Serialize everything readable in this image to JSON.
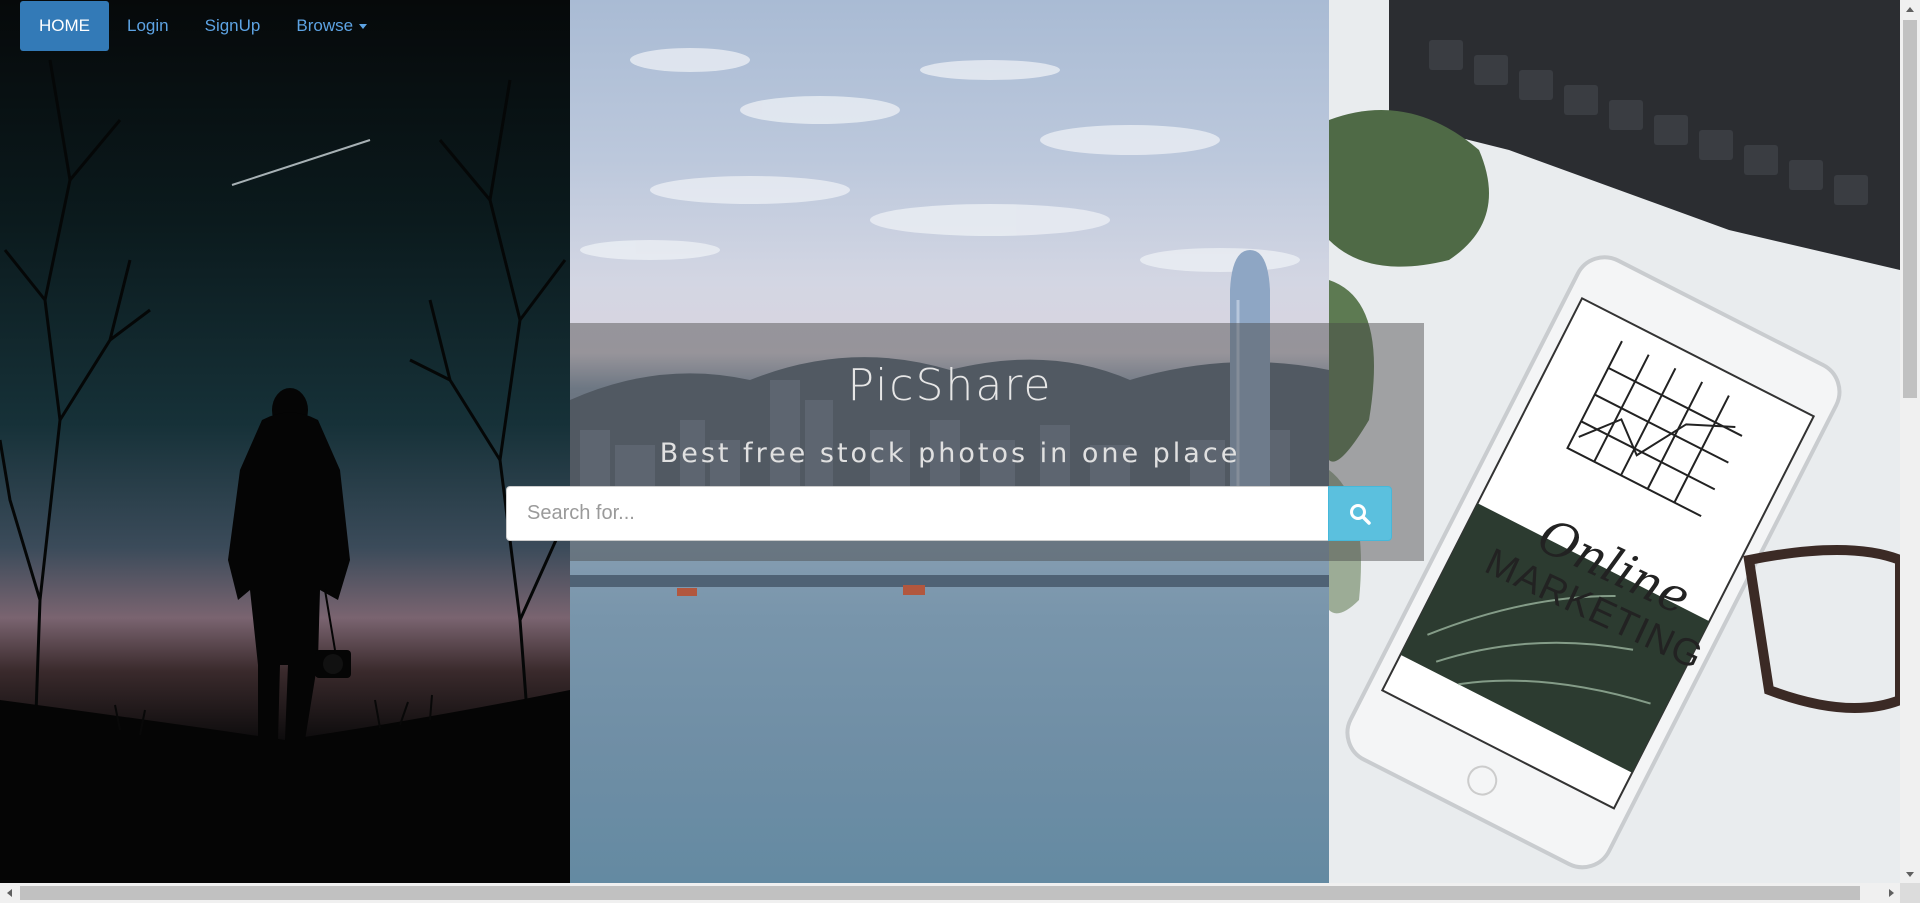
{
  "navbar": {
    "items": [
      {
        "label": "HOME",
        "active": true
      },
      {
        "label": "Login"
      },
      {
        "label": "SignUp"
      },
      {
        "label": "Browse",
        "has_dropdown": true
      }
    ]
  },
  "hero": {
    "title": "PicShare",
    "subtitle": "Best free stock photos in one place"
  },
  "search": {
    "placeholder": "Search for...",
    "button_icon": "search-icon"
  },
  "right_panel_text": {
    "line1": "Online",
    "line2": "MARKETING"
  },
  "colors": {
    "accent": "#337ab7",
    "link": "#5da3e3",
    "search_button": "#5bc0de"
  }
}
